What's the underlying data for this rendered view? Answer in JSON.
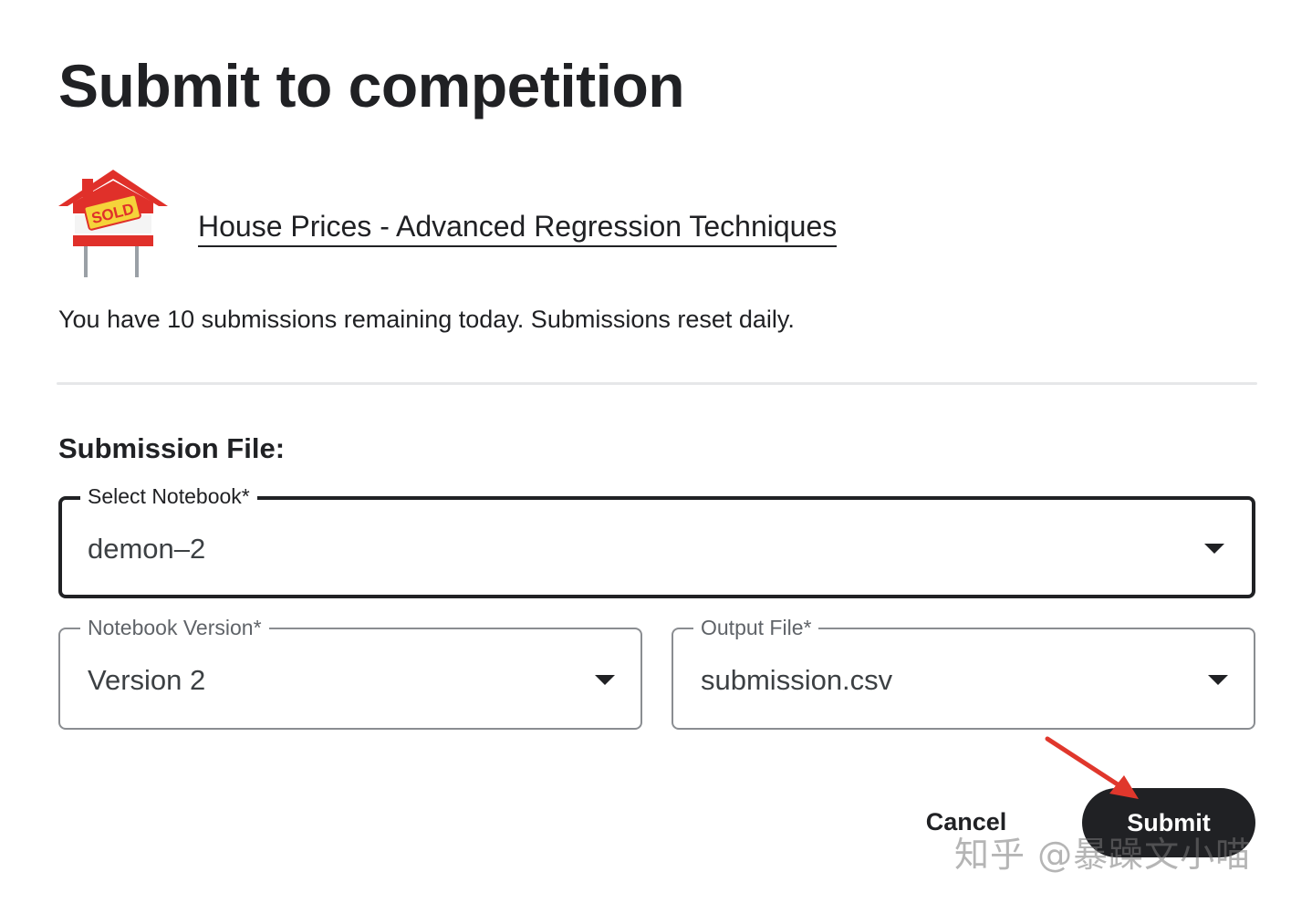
{
  "dialog": {
    "title": "Submit to competition"
  },
  "competition": {
    "name": "House Prices - Advanced Regression Techniques",
    "thumbnail_sign_text": "SOLD"
  },
  "remaining_text": "You have 10 submissions remaining today. Submissions reset daily.",
  "submission_file": {
    "section_label": "Submission File:",
    "notebook": {
      "label": "Select Notebook*",
      "value": "demon–2"
    },
    "version": {
      "label": "Notebook Version*",
      "value": "Version 2"
    },
    "output_file": {
      "label": "Output File*",
      "value": "submission.csv"
    }
  },
  "actions": {
    "cancel_label": "Cancel",
    "submit_label": "Submit"
  },
  "watermark": "知乎 @暴躁文小喵",
  "colors": {
    "text": "#202124",
    "primary_button": "#202124",
    "annotation_arrow": "#e0372c",
    "house_roof": "#e0302a",
    "sold_sign": "#f5d33a"
  }
}
